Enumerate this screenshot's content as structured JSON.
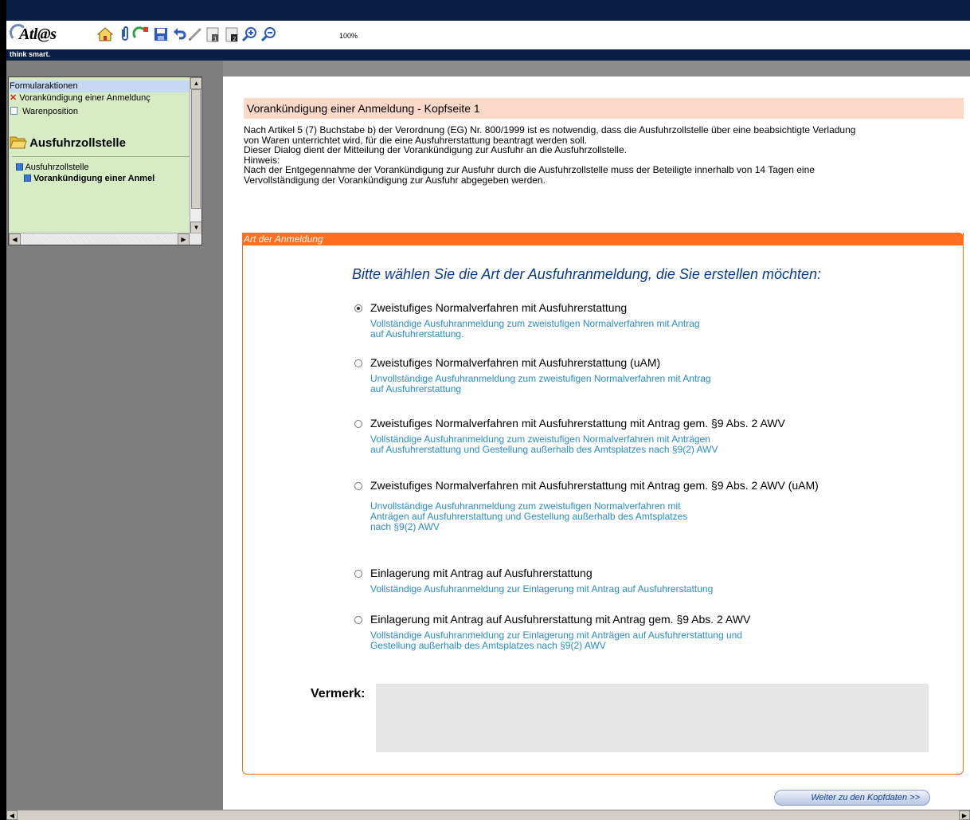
{
  "app": {
    "logo_text": "Atl@s",
    "tagline": "think smart."
  },
  "toolbar": {
    "icons": [
      "home-icon",
      "attach-icon",
      "refresh-icon",
      "save-icon",
      "undo-icon",
      "pen-icon",
      "page-1-icon",
      "page-2-icon",
      "zoom-in-icon",
      "zoom-out-icon"
    ],
    "zoom": "100%"
  },
  "tree": {
    "header": "Formularaktionen",
    "items": [
      {
        "label": "Vorankündigung einer Anmeldunç",
        "icon": "error-x-icon"
      },
      {
        "label": "Warenposition",
        "icon": "document-icon"
      }
    ],
    "section_title": "Ausfuhrzollstelle",
    "nodes": [
      {
        "label": "Ausfuhrzollstelle"
      },
      {
        "label": "Vorankündigung einer Anmel"
      }
    ]
  },
  "main": {
    "title": "Vorankündigung einer Anmeldung - Kopfseite 1",
    "intro": [
      "Nach Artikel 5 (7) Buchstabe b) der Verordnung (EG) Nr. 800/1999 ist es notwendig, dass die Ausfuhrzollstelle über eine beabsichtigte Verladung",
      "von Waren unterrichtet wird, für die eine Ausfuhrerstattung beantragt werden soll.",
      "Dieser Dialog dient der Mitteilung der Vorankündigung zur Ausfuhr an die Ausfuhrzollstelle.",
      "Hinweis:",
      "Nach der Entgegennahme der Vorankündigung zur Ausfuhr durch die Ausfuhrzollstelle muss der Beteiligte innerhalb von 14 Tagen eine",
      "Vervollständigung der Vorankündigung zur Ausfuhr abgegeben werden."
    ],
    "panel_title": "Art der Anmeldung",
    "question": "Bitte wählen Sie die Art der Ausfuhranmeldung, die Sie erstellen möchten:",
    "options": [
      {
        "label": "Zweistufiges Normalverfahren mit Ausfuhrerstattung",
        "desc": "Vollständige Ausfuhranmeldung zum zweistufigen Normalverfahren mit Antrag\nauf Ausfuhrerstattung.",
        "selected": true
      },
      {
        "label": "Zweistufiges Normalverfahren mit Ausfuhrerstattung (uAM)",
        "desc": "Unvollständige Ausfuhranmeldung zum zweistufigen Normalverfahren mit Antrag\nauf Ausfuhrerstattung",
        "selected": false
      },
      {
        "label": "Zweistufiges Normalverfahren mit Ausfuhrerstattung mit Antrag gem. §9 Abs. 2 AWV",
        "desc": "Vollständige Ausfuhranmeldung zum zweistufigen Normalverfahren mit Anträgen\nauf Ausfuhrerstattung und Gestellung außerhalb des Amtsplatzes nach §9(2) AWV",
        "selected": false
      },
      {
        "label": "Zweistufiges Normalverfahren mit Ausfuhrerstattung mit Antrag gem. §9 Abs. 2 AWV (uAM)",
        "desc": "Unvollständige Ausfuhranmeldung zum zweistufigen Normalverfahren mit\nAnträgen auf Ausfuhrerstattung und Gestellung außerhalb des Amtsplatzes\nnach §9(2) AWV",
        "selected": false
      },
      {
        "label": "Einlagerung mit Antrag auf Ausfuhrerstattung",
        "desc": "Vollständige Ausfuhranmeldung zur Einlagerung mit Antrag auf Ausfuhrerstattung",
        "selected": false
      },
      {
        "label": "Einlagerung mit Antrag auf Ausfuhrerstattung mit Antrag gem. §9 Abs. 2 AWV",
        "desc": "Vollständige Ausfuhranmeldung zur Einlagerung mit Anträgen auf Ausfuhrerstattung und\nGestellung außerhalb des Amtsplatzes nach §9(2) AWV",
        "selected": false
      }
    ],
    "vermerk_label": "Vermerk:",
    "vermerk_value": "",
    "next_button": "Weiter zu den Kopfdaten  >>"
  }
}
